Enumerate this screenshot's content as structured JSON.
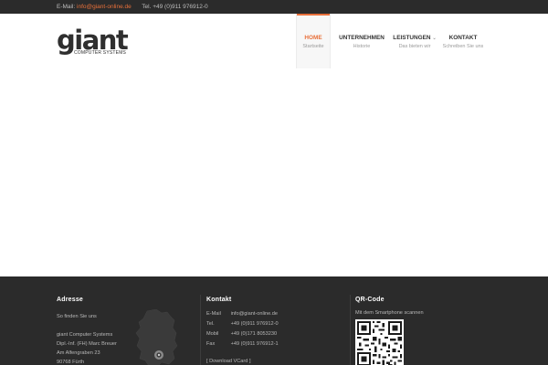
{
  "topbar": {
    "email_label": "E-Mail:",
    "email": "info@giant-online.de",
    "phone": "Tel. +49 (0)911 976912-0"
  },
  "logo": {
    "word": "giant",
    "tagline": "COMPUTER SYSTEMS"
  },
  "nav": [
    {
      "label": "HOME",
      "sub": "Startseite",
      "active": true
    },
    {
      "label": "UNTERNEHMEN",
      "sub": "Historie",
      "active": false
    },
    {
      "label": "LEISTUNGEN",
      "sub": "Das bieten wir",
      "active": false,
      "dropdown": true
    },
    {
      "label": "KONTAKT",
      "sub": "Schreiben Sie uns",
      "active": false
    }
  ],
  "footer": {
    "adresse": {
      "title": "Adresse",
      "intro": "So finden Sie uns",
      "company": "giant Computer Systems",
      "person": "Dipl.-Inf. (FH) Marc Breuer",
      "street": "Am Alfengraben 23",
      "city": "90768 Fürth"
    },
    "kontakt": {
      "title": "Kontakt",
      "rows": [
        {
          "key": "E-Mail",
          "value": "info@giant-online.de"
        },
        {
          "key": "Tel.",
          "value": "+49 (0)911 976912-0"
        },
        {
          "key": "Mobil",
          "value": "+49 (0)171 8053230"
        },
        {
          "key": "Fax",
          "value": "+49 (0)911 976912-1"
        }
      ],
      "vcard": "[ Download VCard ]"
    },
    "qrcode": {
      "title": "QR-Code",
      "intro": "Mit dem Smartphone scannen"
    }
  },
  "colors": {
    "accent": "#e8703a",
    "dark_bg": "#2b2b2b"
  }
}
